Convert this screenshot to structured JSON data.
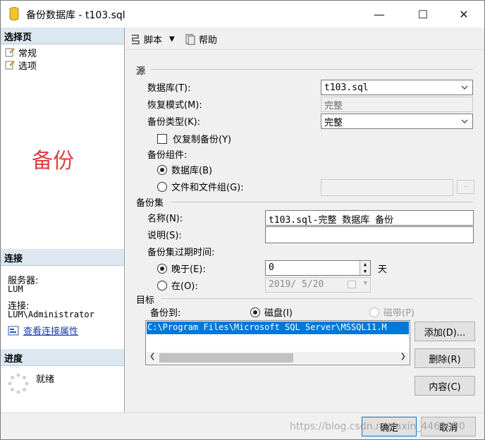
{
  "window": {
    "title": "备份数据库 - t103.sql",
    "minimize": "—",
    "maximize": "☐",
    "close": "✕"
  },
  "left": {
    "select_page": "选择页",
    "pages": [
      "常规",
      "选项"
    ],
    "big_label": "备份",
    "connection_head": "连接",
    "server_label": "服务器:",
    "server_value": "LUM",
    "connection_label": "连接:",
    "connection_value": "LUM\\Administrator",
    "view_props_link": "查看连接属性",
    "progress_head": "进度",
    "progress_status": "就绪"
  },
  "toolbar": {
    "script": "脚本",
    "help": "帮助"
  },
  "source": {
    "group": "源",
    "database_label": "数据库(T):",
    "database_value": "t103.sql",
    "recovery_label": "恢复模式(M):",
    "recovery_value": "完整",
    "backup_type_label": "备份类型(K):",
    "backup_type_value": "完整",
    "copy_only_label": "仅复制备份(Y)",
    "component_label": "备份组件:",
    "component_db": "数据库(B)",
    "component_files": "文件和文件组(G):",
    "files_button": "··"
  },
  "backup_set": {
    "group": "备份集",
    "name_label": "名称(N):",
    "name_value": "t103.sql-完整 数据库 备份",
    "desc_label": "说明(S):",
    "desc_value": "",
    "expire_label": "备份集过期时间:",
    "after_label": "晚于(E):",
    "after_value": "0",
    "days_unit": "天",
    "on_label": "在(O):",
    "on_value": "2019/ 5/20"
  },
  "destination": {
    "group": "目标",
    "backup_to_label": "备份到:",
    "disk_label": "磁盘(I)",
    "tape_label": "磁带(P)",
    "paths": [
      "C:\\Program Files\\Microsoft SQL Server\\MSSQL11.M"
    ],
    "add_button": "添加(D)...",
    "remove_button": "删除(R)",
    "contents_button": "内容(C)"
  },
  "footer": {
    "ok_button": "确定",
    "cancel_button": "取消",
    "watermark": "https://blog.csdn.net/axin_4469030"
  },
  "colors": {
    "accent": "#0078d7",
    "section_header": "#dce7f1",
    "red_label": "#e04040",
    "link": "#1a3fa8"
  }
}
